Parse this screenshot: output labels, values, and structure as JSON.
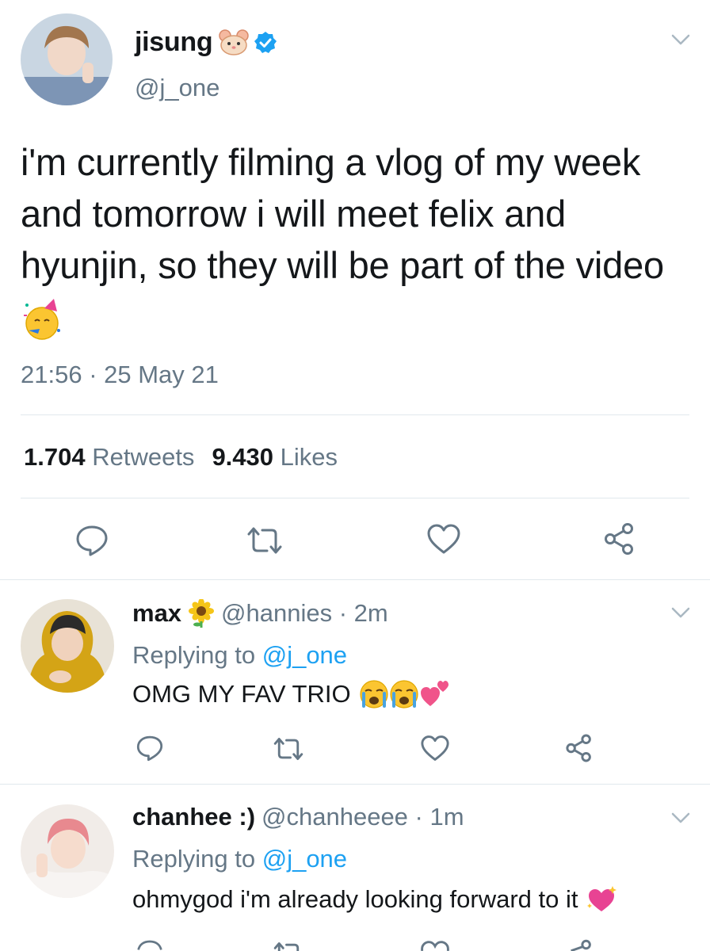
{
  "tweet": {
    "name": "jisung",
    "handle": "@j_one",
    "text": "i'm currently filming a vlog of my week and tomorrow i will meet felix and hyunjin, so they will be part of the video",
    "timestamp": "21:56 · 25 May 21",
    "retweets_count": "1.704",
    "retweets_label": "Retweets",
    "likes_count": "9.430",
    "likes_label": "Likes"
  },
  "replies": [
    {
      "name": "max",
      "handle_time": "@hannies · 2m",
      "replying_label": "Replying to",
      "replying_to": "@j_one",
      "text": "OMG MY FAV TRIO"
    },
    {
      "name": "chanhee :)",
      "handle_time": "@chanheeee · 1m",
      "replying_label": "Replying to",
      "replying_to": "@j_one",
      "text": "ohmygod i'm already looking forward to it"
    }
  ],
  "icons": [
    "hamster-icon",
    "verified-badge-icon",
    "partying-face-icon",
    "sunflower-icon",
    "loudly-crying-face-icon",
    "two-hearts-icon",
    "sparkling-heart-icon",
    "reply-icon",
    "retweet-icon",
    "like-icon",
    "share-icon",
    "chevron-down-icon"
  ],
  "colors": {
    "text": "#14171a",
    "secondary": "#657786",
    "link": "#1da1f2",
    "divider": "#e1e8ed"
  }
}
